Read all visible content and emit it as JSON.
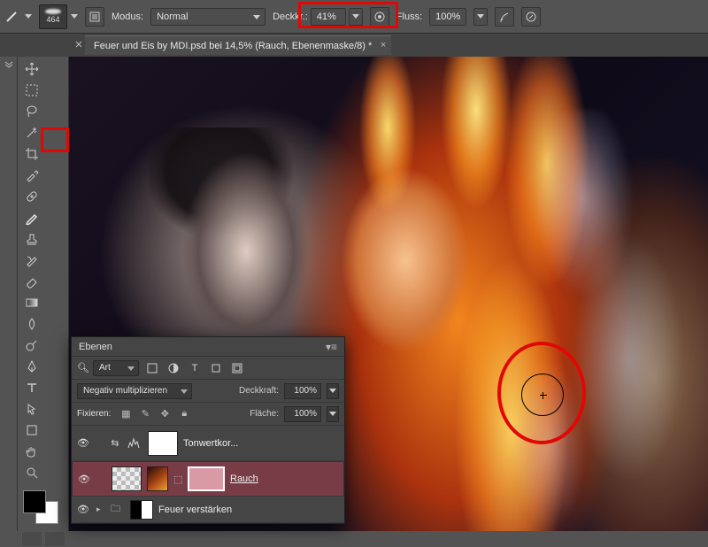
{
  "optionsBar": {
    "brushSize": "464",
    "modeLabel": "Modus:",
    "modeValue": "Normal",
    "opacityLabel": "Deckkr.:",
    "opacityValue": "41%",
    "flowLabel": "Fluss:",
    "flowValue": "100%"
  },
  "documentTab": {
    "title": "Feuer und Eis by MDI.psd bei 14,5% (Rauch, Ebenenmaske/8) *"
  },
  "layersPanel": {
    "title": "Ebenen",
    "kind": "Art",
    "blendMode": "Negativ multiplizieren",
    "opacityLabel": "Deckkraft:",
    "opacityValue": "100%",
    "lockLabel": "Fixieren:",
    "fillLabel": "Fläche:",
    "fillValue": "100%",
    "rows": [
      {
        "name": "Tonwertkor..."
      },
      {
        "name": "Rauch"
      },
      {
        "name": "Feuer verstärken"
      }
    ]
  },
  "annotations": {
    "highlightTool": "brush",
    "highlightOpacity": true,
    "cursorCircle": true
  }
}
